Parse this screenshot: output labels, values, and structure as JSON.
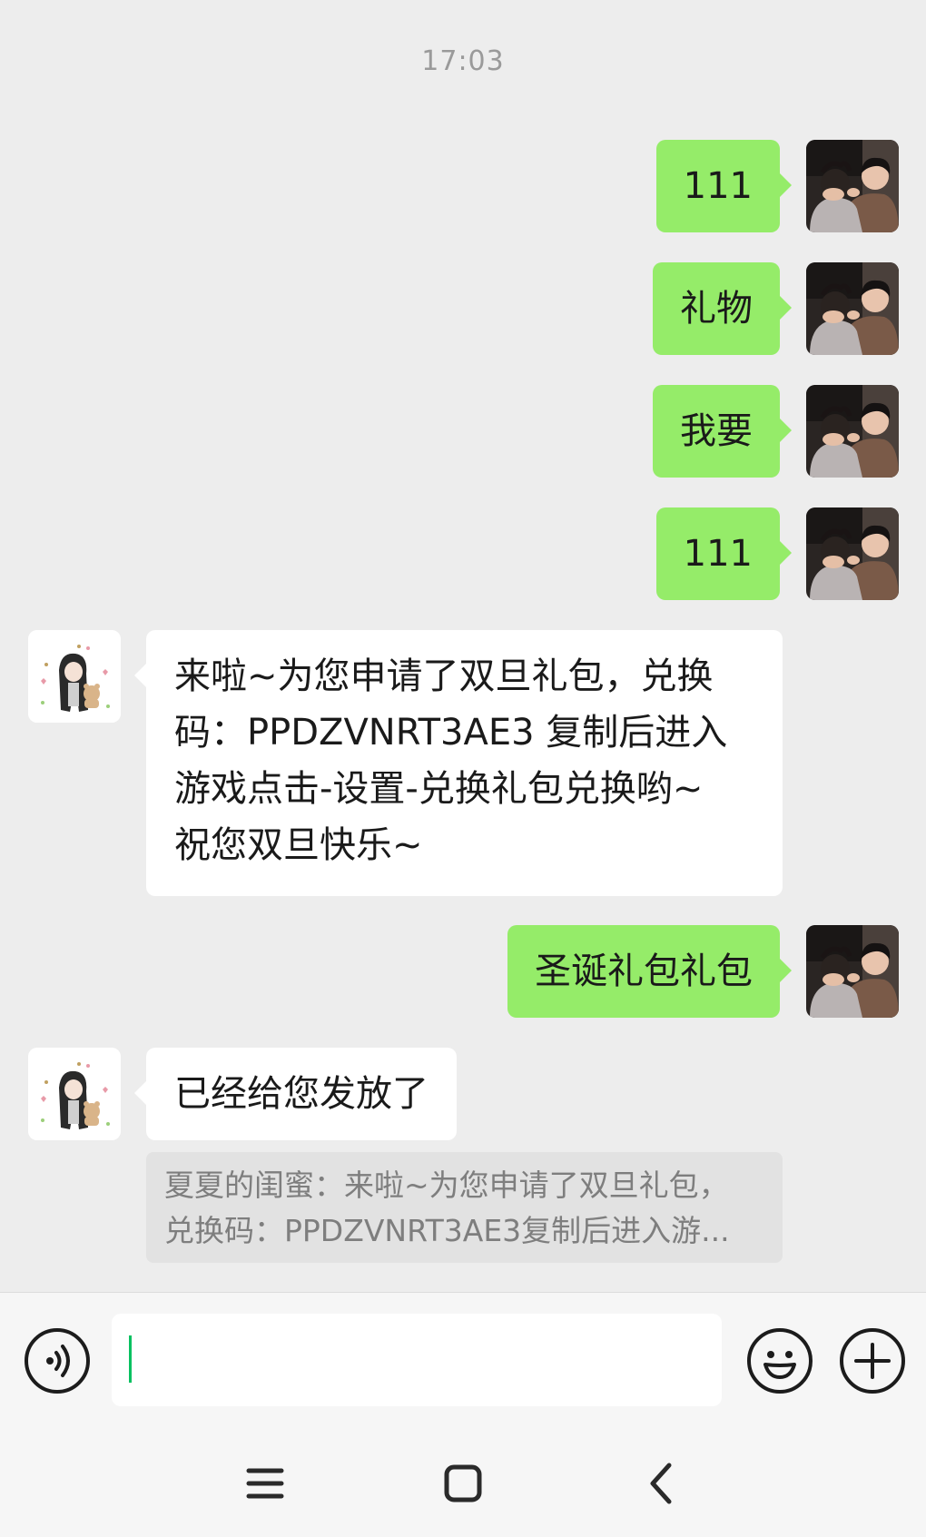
{
  "chat": {
    "timestamp": "17:03",
    "messages": [
      {
        "from": "me",
        "text": "111"
      },
      {
        "from": "me",
        "text": "礼物"
      },
      {
        "from": "me",
        "text": "我要"
      },
      {
        "from": "me",
        "text": "111"
      },
      {
        "from": "them",
        "lines": [
          "来啦~为您申请了双旦礼包，兑换",
          "码：PPDZVNRT3AE3 复制后进入",
          "游戏点击-设置-兑换礼包兑换哟~",
          "祝您双旦快乐~"
        ]
      },
      {
        "from": "me",
        "text": "圣诞礼包礼包"
      },
      {
        "from": "them",
        "text": "已经给您发放了"
      }
    ],
    "quote": {
      "line1": "夏夏的闺蜜：来啦~为您申请了双旦礼包，",
      "line2": "兑换码：PPDZVNRT3AE3复制后进入游..."
    }
  },
  "input_bar": {
    "voice_icon": "voice-icon",
    "message_value": "",
    "emoji_icon": "emoji-icon",
    "plus_icon": "plus-icon",
    "caret_color": "#07c160"
  },
  "nav": {
    "menu_icon": "menu-icon",
    "home_icon": "home-icon",
    "back_icon": "back-icon"
  },
  "colors": {
    "background": "#ededed",
    "outgoing_bubble": "#95ec69",
    "incoming_bubble": "#ffffff",
    "quote_background": "#e2e2e2"
  }
}
